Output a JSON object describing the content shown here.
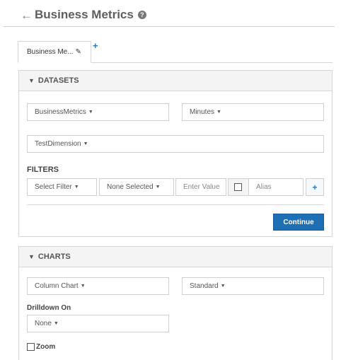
{
  "header": {
    "title": "Business Metrics",
    "back_icon": "←",
    "help_icon": "?"
  },
  "tabs": [
    {
      "label": "Business Me..."
    }
  ],
  "add_tab_label": "+",
  "datasets": {
    "heading": "DATASETS",
    "metric_select": "BusinessMetrics",
    "interval_select": "Minutes",
    "dimension_select": "TestDimension",
    "filters_label": "FILTERS",
    "filter_select": "Select Filter",
    "values_select": "None Selected",
    "value_placeholder": "Enter Value",
    "alias_placeholder": "Alias",
    "add_filter_label": "+",
    "continue_label": "Continue"
  },
  "charts": {
    "heading": "CHARTS",
    "chart_type_select": "Column Chart",
    "style_select": "Standard",
    "drilldown_label": "Drilldown On",
    "drilldown_select": "None",
    "zoom_label": "Zoom"
  },
  "colors": {
    "primary": "#1f6fb5",
    "accent_link": "#2a7abf",
    "panel_header": "#f4f4f4",
    "border": "#d6d6d6"
  }
}
